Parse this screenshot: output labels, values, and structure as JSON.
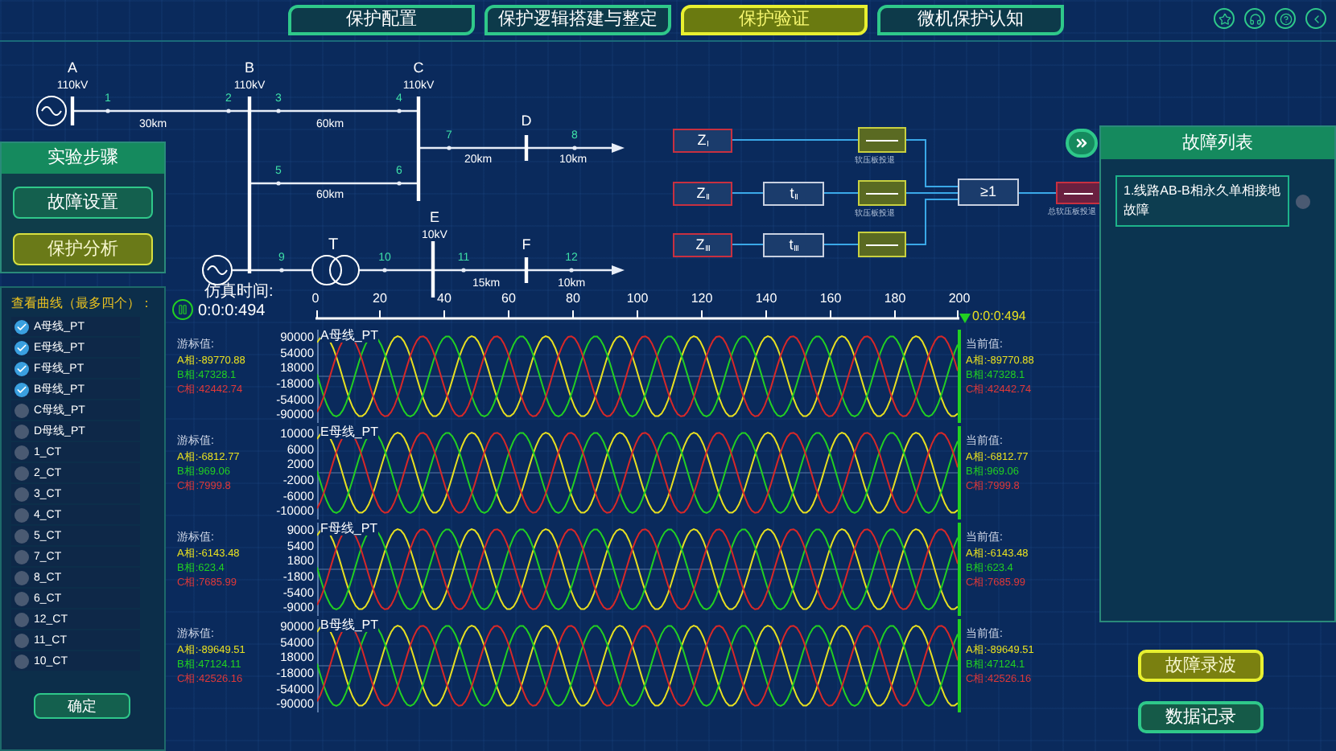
{
  "nav_tabs": [
    {
      "label": "保护配置",
      "selected": false
    },
    {
      "label": "保护逻辑搭建与整定",
      "selected": false
    },
    {
      "label": "保护验证",
      "selected": true
    },
    {
      "label": "微机保护认知",
      "selected": false
    }
  ],
  "diagram": {
    "buses": [
      {
        "name": "A",
        "voltage": "110kV"
      },
      {
        "name": "B",
        "voltage": "110kV"
      },
      {
        "name": "C",
        "voltage": "110kV"
      },
      {
        "name": "D"
      },
      {
        "name": "E",
        "voltage": "10kV"
      },
      {
        "name": "F"
      }
    ],
    "nodes": [
      "1",
      "2",
      "3",
      "4",
      "5",
      "6",
      "7",
      "8",
      "9",
      "10",
      "11",
      "12"
    ],
    "distances": [
      "30km",
      "60km",
      "60km",
      "20km",
      "10km",
      "15km",
      "10km"
    ],
    "transformer": "T"
  },
  "logic": {
    "switches": [
      {
        "on": true
      },
      {
        "on": true
      },
      {
        "on": true
      }
    ],
    "master_switch": {
      "on": true
    },
    "relays": [
      "Z$_{Ⅰ}$",
      "Z$_{Ⅱ}$",
      "Z$_{Ⅲ}$"
    ],
    "timers": [
      "t$_{Ⅱ}$",
      "t$_{Ⅲ}$"
    ],
    "gate": "≥1",
    "switch_labels": [
      "软压板投退",
      "软压板投退"
    ],
    "master_switch_label": "总软压板投退"
  },
  "experiment_steps": {
    "title": "实验步骤",
    "buttons": [
      {
        "label": "故障设置",
        "selected": false
      },
      {
        "label": "保护分析",
        "selected": true
      }
    ]
  },
  "curve_list": {
    "title": "查看曲线（最多四个）：",
    "items": [
      {
        "label": "A母线_PT",
        "checked": true
      },
      {
        "label": "E母线_PT",
        "checked": true
      },
      {
        "label": "F母线_PT",
        "checked": true
      },
      {
        "label": "B母线_PT",
        "checked": true
      },
      {
        "label": "C母线_PT",
        "checked": false
      },
      {
        "label": "D母线_PT",
        "checked": false
      },
      {
        "label": "1_CT",
        "checked": false
      },
      {
        "label": "2_CT",
        "checked": false
      },
      {
        "label": "3_CT",
        "checked": false
      },
      {
        "label": "4_CT",
        "checked": false
      },
      {
        "label": "5_CT",
        "checked": false
      },
      {
        "label": "7_CT",
        "checked": false
      },
      {
        "label": "8_CT",
        "checked": false
      },
      {
        "label": "6_CT",
        "checked": false
      },
      {
        "label": "12_CT",
        "checked": false
      },
      {
        "label": "11_CT",
        "checked": false
      },
      {
        "label": "10_CT",
        "checked": false
      }
    ],
    "confirm": "确定"
  },
  "simulation": {
    "time_label": "仿真时间:",
    "time": "0:0:0:494",
    "running": true,
    "xticks": [
      "0",
      "20",
      "40",
      "60",
      "80",
      "100",
      "120",
      "140",
      "160",
      "180",
      "200"
    ],
    "marker_time": "0:0:0:494"
  },
  "plots": [
    {
      "title": "A母线_PT",
      "cursor_label": "游标值:",
      "cursor": [
        "A相:-89770.88",
        "B相:47328.1",
        "C相:42442.74"
      ],
      "yticks": [
        "90000",
        "54000",
        "18000",
        "-18000",
        "-54000",
        "-90000"
      ],
      "current_label": "当前值:",
      "current": [
        "A相:-89770.88",
        "B相:47328.1",
        "C相:42442.74"
      ]
    },
    {
      "title": "E母线_PT",
      "cursor_label": "游标值:",
      "cursor": [
        "A相:-6812.77",
        "B相:969.06",
        "C相:7999.8"
      ],
      "yticks": [
        "10000",
        "6000",
        "2000",
        "-2000",
        "-6000",
        "-10000"
      ],
      "current_label": "当前值:",
      "current": [
        "A相:-6812.77",
        "B相:969.06",
        "C相:7999.8"
      ]
    },
    {
      "title": "F母线_PT",
      "cursor_label": "游标值:",
      "cursor": [
        "A相:-6143.48",
        "B相:623.4",
        "C相:7685.99"
      ],
      "yticks": [
        "9000",
        "5400",
        "1800",
        "-1800",
        "-5400",
        "-9000"
      ],
      "current_label": "当前值:",
      "current": [
        "A相:-6143.48",
        "B相:623.4",
        "C相:7685.99"
      ]
    },
    {
      "title": "B母线_PT",
      "cursor_label": "游标值:",
      "cursor": [
        "A相:-89649.51",
        "B相:47124.11",
        "C相:42526.16"
      ],
      "yticks": [
        "90000",
        "54000",
        "18000",
        "-18000",
        "-54000",
        "-90000"
      ],
      "current_label": "当前值:",
      "current": [
        "A相:-89649.51",
        "B相:47124.1",
        "C相:42526.16"
      ]
    }
  ],
  "fault_list": {
    "title": "故障列表",
    "items": [
      {
        "label": "1.线路AB-B相永久单相接地故障",
        "checked": false
      }
    ]
  },
  "actions": [
    {
      "label": "故障录波",
      "selected": true
    },
    {
      "label": "数据记录",
      "selected": false
    }
  ]
}
